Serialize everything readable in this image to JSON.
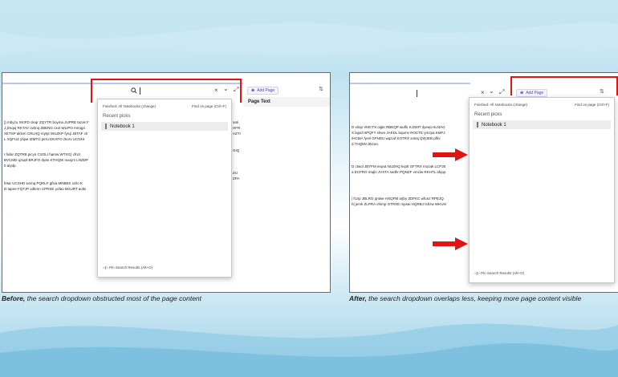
{
  "colors": {
    "highlight_red": "#e11414",
    "accent_purple": "#5b3fb2"
  },
  "before": {
    "caption_strong": "Before,",
    "caption_rest": " the search dropdown obstructed most of the page content",
    "search_icon": "search-icon",
    "search_value": "",
    "clear_glyph": "×",
    "chevron_glyph": "⌄",
    "expand_glyph": "⤢",
    "add_page_label": "Add Page",
    "page_text_label": "Page Text",
    "dropdown": {
      "scope": "Finished:  All Notebooks (change)",
      "find_on_page": "Find on page (Ctrl+F)",
      "recent_label": "Recent picks",
      "recent_item": "Notebook 1",
      "pin_results": "Pin Search Results (Alt+O)"
    },
    "text_lines_1": [
      "[) mbyzu XKIFD cleqr ZQYTR boyma JUPRE tazxk F",
      "J jlmqoj RKTAV ovlmq ZBENG cxol WLIPO mmqpi",
      "XETSP aklxm CRLHQ mytyt WUZKP fyrqi JBTAF clr",
      "L XQFUZ yfqwi IZMTG pirru DKXFO zkorv UCNHI"
    ],
    "text_lines_2": [
      "I fixlar ZQTRB picyn CSOLI hamw WTXG) cfnzr",
      "BVCMD qzwpt BRJFO dyan KTHQW nuoym LNZDP",
      "0 aiydp."
    ],
    "text_lines_3": [
      "fetar UCSHD wzmq PQRLF gfiva MNBEK szilo K",
      "D tapne FQTJP xdkmn CPRSE yofao BGURT aoltx"
    ],
    "side_text": [
      "sati",
      "HFR",
      "AZTI",
      "",
      "",
      "GIQ",
      "",
      "",
      "",
      "ZU",
      "ZPA"
    ]
  },
  "after": {
    "caption_strong": "After,",
    "caption_rest": " the search dropdown overlaps less, keeping more page content visible",
    "clear_glyph": "×",
    "chevron_glyph": "⌄",
    "expand_glyph": "⤢",
    "add_page_label": "Add Page",
    "dropdown": {
      "scope": "Finished:  All Notebooks (change)",
      "find_on_page": "Find on page (Ctrl+F)",
      "recent_label": "Recent picks",
      "recent_item": "Notebook 1",
      "pin_results": "Pin Search Results (Alt+O)"
    },
    "text_lines_1": [
      "D xlrsp VMCTX oigle RBEQP wulfn KJSMT dyeep HLNAG",
      "X lajod HPQFY slrwn JAKDL bqumv ROCTE ymzpa KMFJ",
      "IHCMA fyrel GFNDU wqzvd KOTRX smlaj QWJEB plfni",
      "d THQMA bkzun."
    ],
    "text_lines_2": [
      "D ctwol JBYFM erqna NUZHQ kvptl GFTRX mozak LCPJE",
      "a ECFRO mtqln JVXTA sedhr PQNZF vmclw RKHTL afqop"
    ],
    "text_lines_3": [
      "| fczip JBLRO qntwe HXQFM arjby ZDFKC wfunz RPEJQ",
      "h| jervk ZLPRA cfemp GTRXE mpsai HQRBJ tshzw WKUN"
    ]
  }
}
